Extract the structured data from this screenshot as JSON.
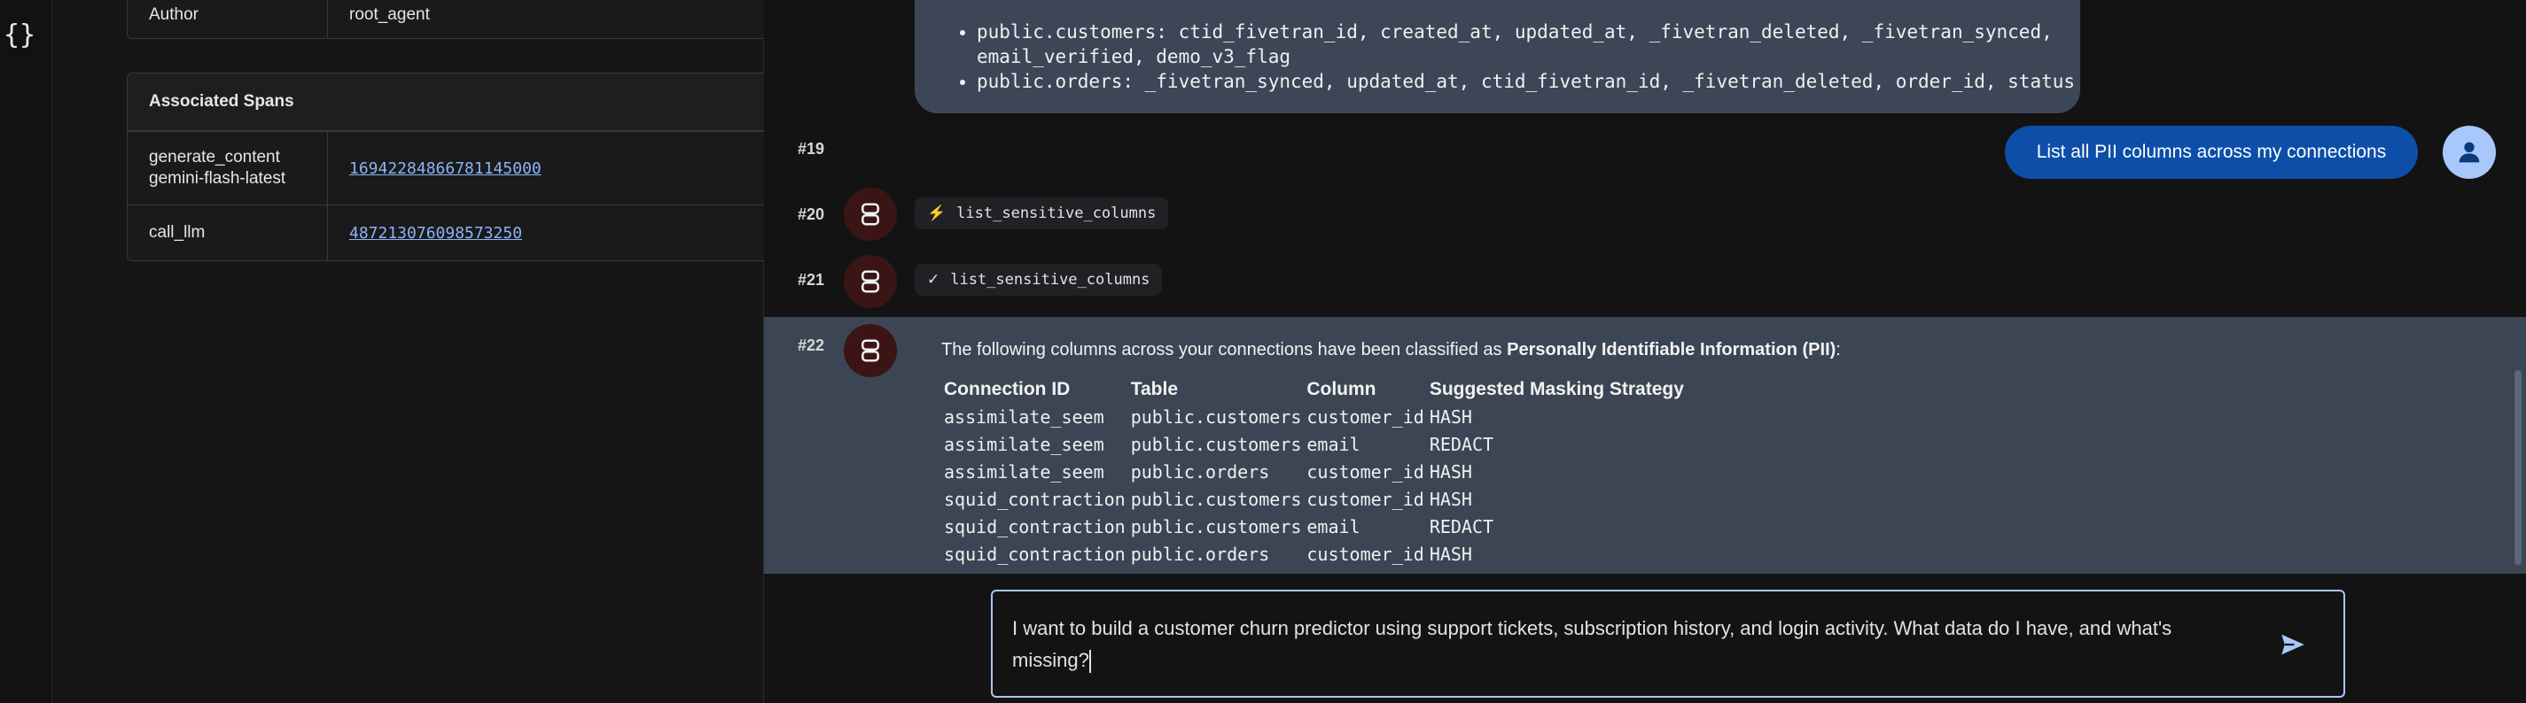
{
  "left_panel": {
    "info_rows": [
      {
        "key": "Author",
        "value": "root_agent"
      }
    ],
    "associated_spans": {
      "title": "Associated Spans",
      "rows": [
        {
          "key": "generate_content\ngemini-flash-latest",
          "value": "16942284866781145000"
        },
        {
          "key": "call_llm",
          "value": "487213076098573250"
        }
      ]
    }
  },
  "chat": {
    "top_message": {
      "items": [
        "public.customers: ctid_fivetran_id, created_at, updated_at, _fivetran_deleted, _fivetran_synced, email_verified, demo_v3_flag",
        "public.orders: _fivetran_synced, updated_at, ctid_fivetran_id, _fivetran_deleted, order_id, status"
      ]
    },
    "events": [
      {
        "num": "#19"
      },
      {
        "num": "#20",
        "chip_label": "list_sensitive_columns",
        "chip_icon": "bolt-icon"
      },
      {
        "num": "#21",
        "chip_label": "list_sensitive_columns",
        "chip_icon": "check-icon"
      },
      {
        "num": "#22"
      }
    ],
    "user_message": "List all PII columns across my connections",
    "pii_response": {
      "intro_prefix": "The following columns across your connections have been classified as ",
      "intro_bold": "Personally Identifiable Information (PII)",
      "intro_suffix": ":",
      "columns": [
        "Connection ID",
        "Table",
        "Column",
        "Suggested Masking Strategy"
      ],
      "rows": [
        [
          "assimilate_seem",
          "public.customers",
          "customer_id",
          "HASH"
        ],
        [
          "assimilate_seem",
          "public.customers",
          "email",
          "REDACT"
        ],
        [
          "assimilate_seem",
          "public.orders",
          "customer_id",
          "HASH"
        ],
        [
          "squid_contraction",
          "public.customers",
          "customer_id",
          "HASH"
        ],
        [
          "squid_contraction",
          "public.customers",
          "email",
          "REDACT"
        ],
        [
          "squid_contraction",
          "public.orders",
          "customer_id",
          "HASH"
        ]
      ]
    }
  },
  "input": {
    "value": "I want to build a customer churn predictor using support tickets, subscription history, and login activity. What data do I have, and what's missing?"
  },
  "colors": {
    "accent": "#a8c7fa",
    "user_bubble": "#0d4fa8",
    "agent_avatar": "#3b1515",
    "model_bubble": "#3c4657"
  }
}
